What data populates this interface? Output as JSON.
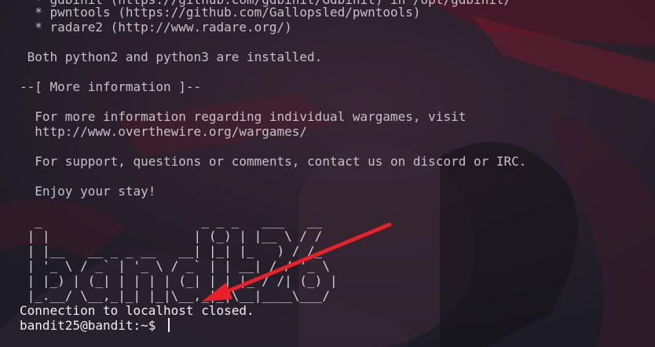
{
  "motd": {
    "top_partial": "  * gdbinit (https://github.com/gdbinit/Gdbinit) in /opt/gdbinit/",
    "tool_pwntools": "  * pwntools (https://github.com/Gallopsled/pwntools)",
    "tool_radare2": "  * radare2 (http://www.radare.org/)",
    "python_note": " Both python2 and python3 are installed.",
    "more_info_header": "--[ More information ]--",
    "info_line1": "  For more information regarding individual wargames, visit",
    "info_line2": "  http://www.overthewire.org/wargames/",
    "support_line": "  For support, questions or comments, contact us on discord or IRC.",
    "enjoy_line": "  Enjoy your stay!"
  },
  "banner": {
    "lines": [
      "  _                     _ _ _   ___   __",
      " | |                   | (_) | |__ \\ / /",
      " | |__   __ _ _ __   __| |_| |_   ) / /_",
      " | '_ \\ / _` | '_ \\ / _` | | __| / / '_ \\",
      " | |_) | (_| | | | | (_| | | |_ / /| (_) |",
      " |_.__/ \\__,_|_| |_|\\__,_|_|\\__|____\\___/"
    ]
  },
  "session": {
    "closed_message": "Connection to localhost closed.",
    "prompt": "bandit25@bandit:~$ "
  },
  "colors": {
    "arrow": "#e8202a",
    "background": "#1f1e26",
    "text": "#e7e3e7"
  }
}
